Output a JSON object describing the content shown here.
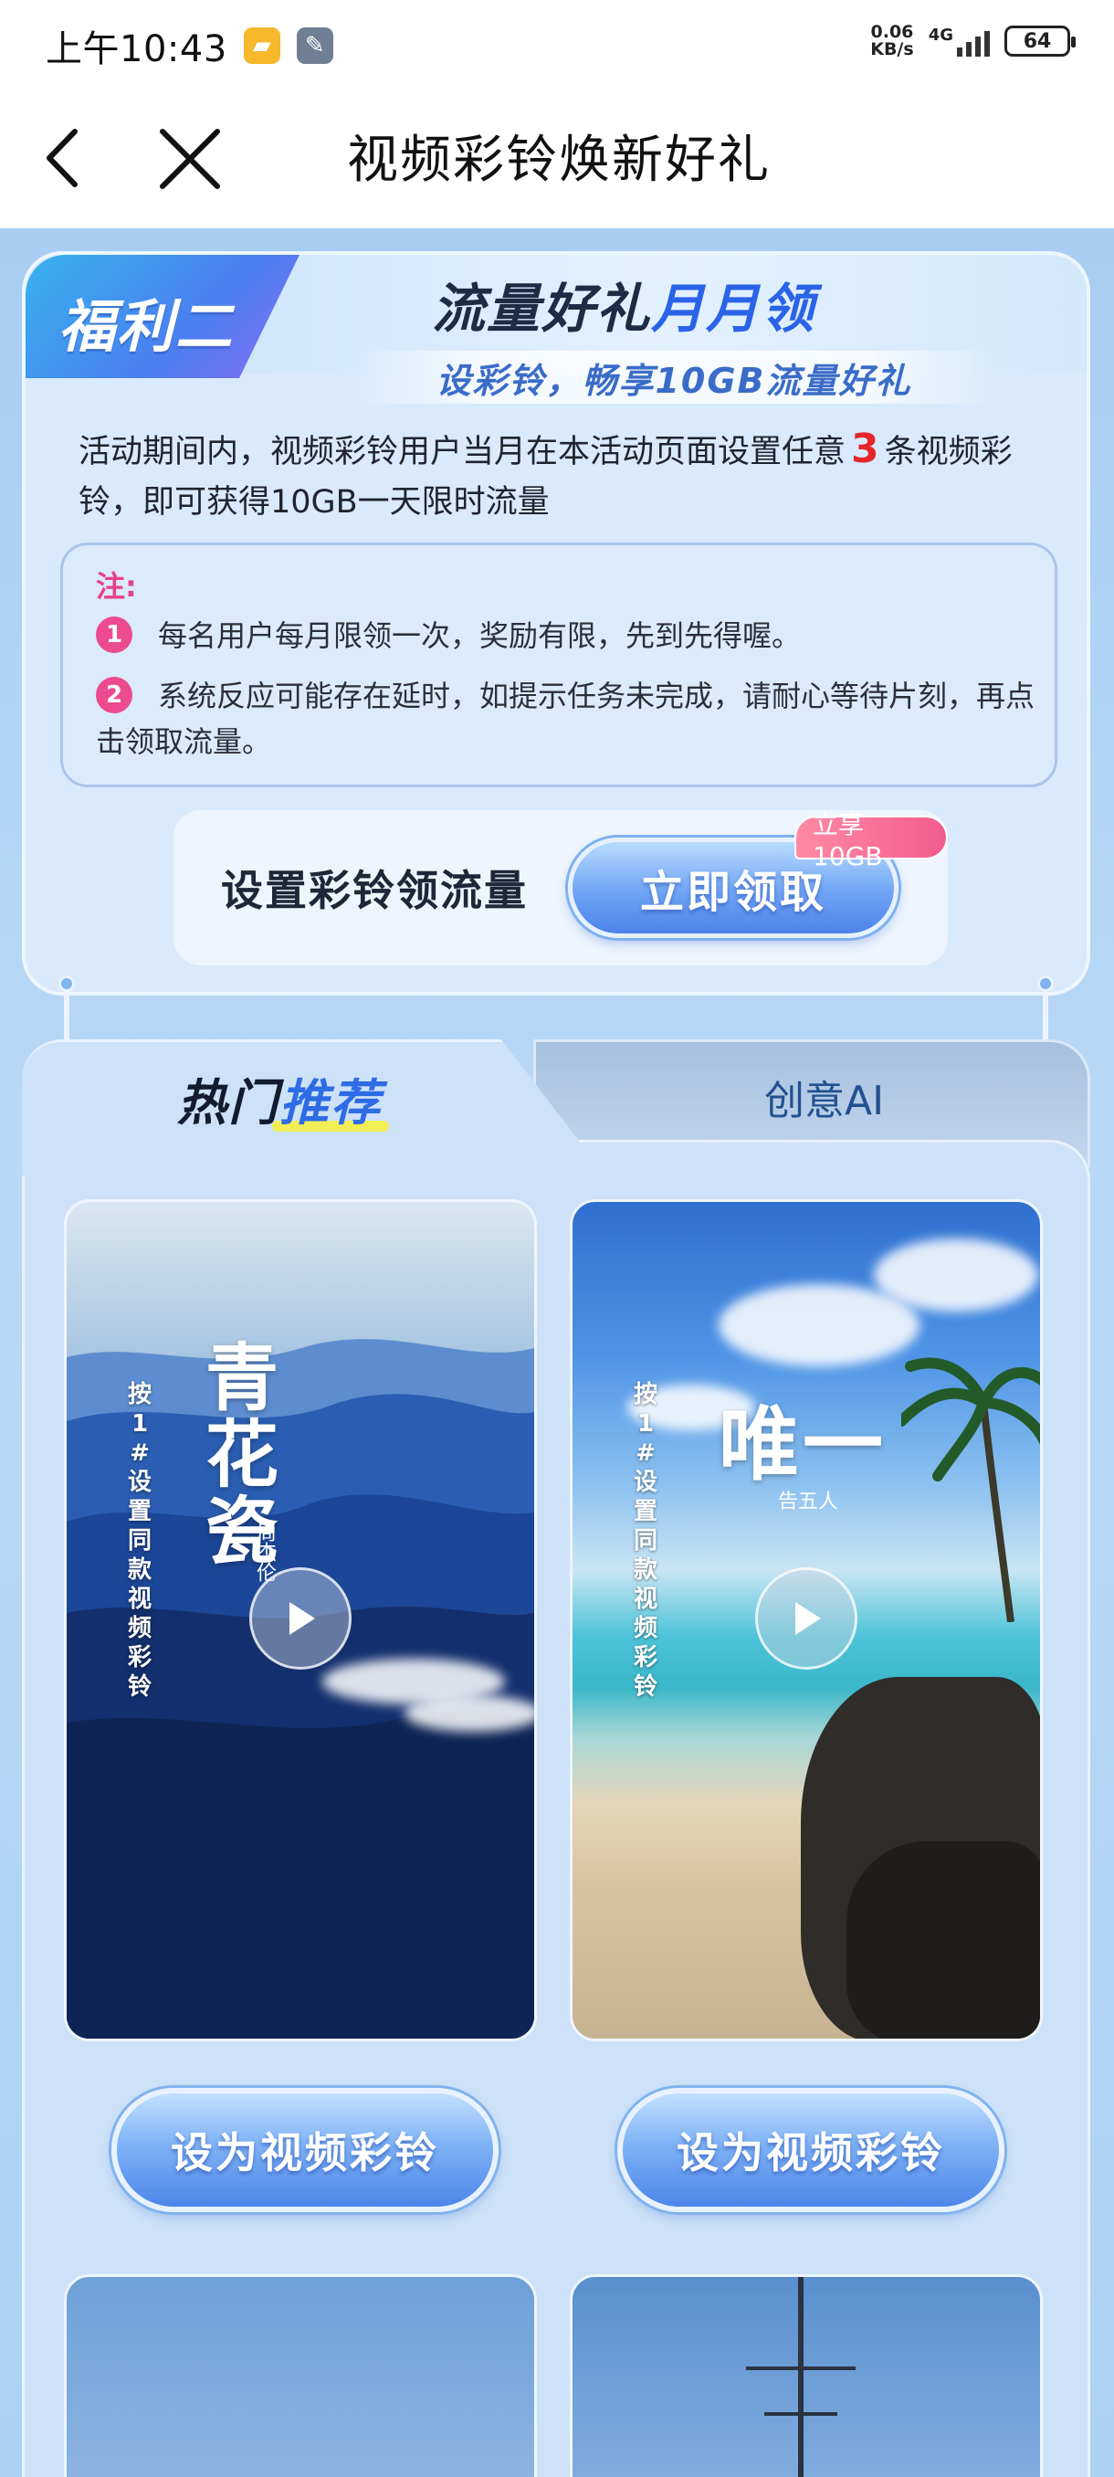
{
  "status_bar": {
    "time": "上午10:43",
    "net_speed_value": "0.06",
    "net_speed_unit": "KB/s",
    "network": "4G",
    "battery": "64"
  },
  "nav": {
    "title": "视频彩铃焕新好礼"
  },
  "benefit": {
    "tab_label": "福利二",
    "title_main": "流量好礼",
    "title_highlight": "月月领",
    "subtitle": "设彩铃，畅享10GB流量好礼",
    "desc_before": "活动期间内，视频彩铃用户当月在本活动页面设置任意",
    "desc_count": "3",
    "desc_after": "条视频彩铃，即可获得10GB一天限时流量",
    "note_title": "注:",
    "notes": [
      {
        "num": "1",
        "text": "每名用户每月限领一次，奖励有限，先到先得喔。"
      },
      {
        "num": "2",
        "text": "系统反应可能存在延时，如提示任务未完成，请耐心等待片刻，再点击领取流量。"
      }
    ],
    "claim_label": "设置彩铃领流量",
    "claim_button": "立即领取",
    "claim_badge": "立享10GB"
  },
  "tabs": {
    "left_prefix": "热门",
    "left_highlight": "推荐",
    "right_label": "创意AI"
  },
  "videos": [
    {
      "title": "青花瓷",
      "artist": "周杰伦",
      "side_text": "按1#设置同款视频彩铃",
      "button": "设为视频彩铃"
    },
    {
      "title": "唯一",
      "artist": "告五人",
      "side_text": "按1#设置同款视频彩铃",
      "button": "设为视频彩铃"
    }
  ],
  "colors": {
    "accent": "#2e6ce6",
    "highlight": "#f3f25a",
    "badge": "#f25c8e",
    "note_pink": "#ec4b8f",
    "count_red": "#e6262a"
  }
}
